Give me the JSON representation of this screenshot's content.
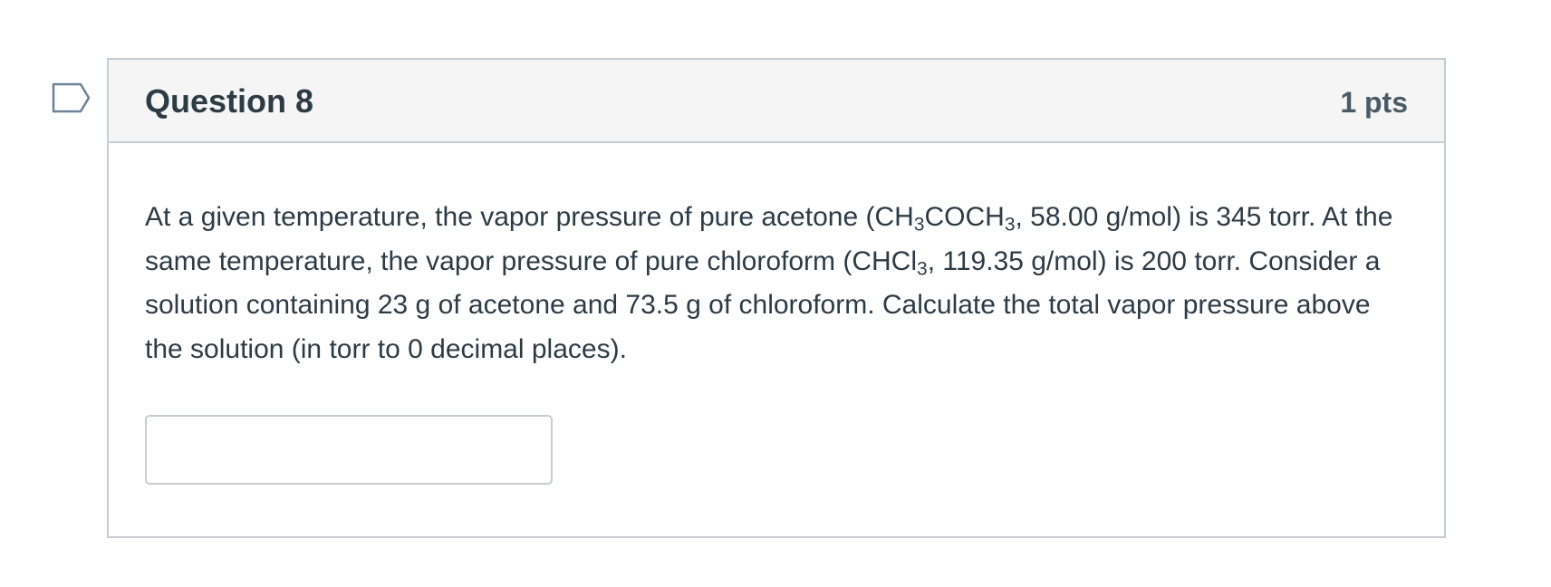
{
  "question": {
    "title": "Question 8",
    "points": "1 pts",
    "flag_icon": "bookmark-flag-icon",
    "text": {
      "part1": "At a given temperature, the vapor pressure of pure acetone (CH",
      "sub1": "3",
      "part2": "COCH",
      "sub2": "3",
      "part3": ", 58.00 g/mol) is 345 torr. At the same temperature, the vapor pressure of pure chloroform (CHCl",
      "sub3": "3",
      "part4": ", 119.35 g/mol) is 200 torr. Consider a solution containing 23 g of acetone and 73.5 g of chloroform.  Calculate the total vapor pressure above the solution (in torr to 0 decimal places)."
    },
    "answer": {
      "value": "",
      "placeholder": ""
    }
  },
  "colors": {
    "border": "#c7cdd1",
    "header_bg": "#f5f5f5",
    "text": "#2d3b45",
    "flag": "#6b8299"
  }
}
